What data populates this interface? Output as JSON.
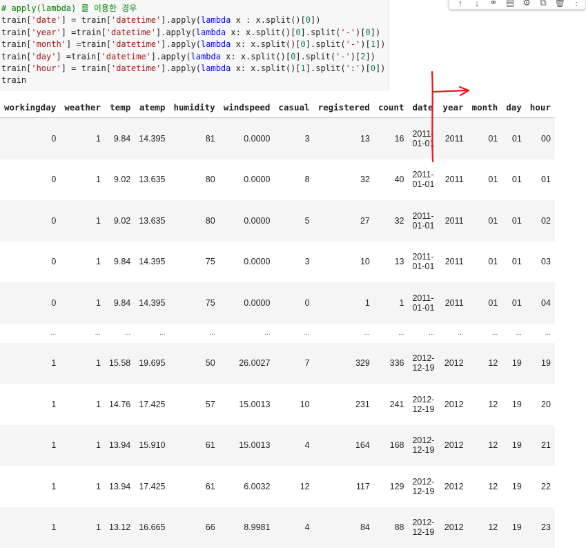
{
  "code": {
    "lines": [
      [
        {
          "t": "# apply(lambda) 를 이용한 경우",
          "c": "c-comment"
        }
      ],
      [
        {
          "t": "train[",
          "c": ""
        },
        {
          "t": "'date'",
          "c": "c-str"
        },
        {
          "t": "] = train[",
          "c": ""
        },
        {
          "t": "'datetime'",
          "c": "c-str"
        },
        {
          "t": "].apply(",
          "c": ""
        },
        {
          "t": "lambda",
          "c": "c-kw"
        },
        {
          "t": " x : x.split()[",
          "c": ""
        },
        {
          "t": "0",
          "c": "c-num"
        },
        {
          "t": "])",
          "c": ""
        }
      ],
      [
        {
          "t": "train[",
          "c": ""
        },
        {
          "t": "'year'",
          "c": "c-str"
        },
        {
          "t": "] =train[",
          "c": ""
        },
        {
          "t": "'datetime'",
          "c": "c-str"
        },
        {
          "t": "].apply(",
          "c": ""
        },
        {
          "t": "lambda",
          "c": "c-kw"
        },
        {
          "t": " x: x.split()[",
          "c": ""
        },
        {
          "t": "0",
          "c": "c-num"
        },
        {
          "t": "].split(",
          "c": ""
        },
        {
          "t": "'-'",
          "c": "c-str"
        },
        {
          "t": ")[",
          "c": ""
        },
        {
          "t": "0",
          "c": "c-num"
        },
        {
          "t": "])",
          "c": ""
        }
      ],
      [
        {
          "t": "train[",
          "c": ""
        },
        {
          "t": "'month'",
          "c": "c-str"
        },
        {
          "t": "] =train[",
          "c": ""
        },
        {
          "t": "'datetime'",
          "c": "c-str"
        },
        {
          "t": "].apply(",
          "c": ""
        },
        {
          "t": "lambda",
          "c": "c-kw"
        },
        {
          "t": " x: x.split()[",
          "c": ""
        },
        {
          "t": "0",
          "c": "c-num"
        },
        {
          "t": "].split(",
          "c": ""
        },
        {
          "t": "'-'",
          "c": "c-str"
        },
        {
          "t": ")[",
          "c": ""
        },
        {
          "t": "1",
          "c": "c-num"
        },
        {
          "t": "])",
          "c": ""
        }
      ],
      [
        {
          "t": "train[",
          "c": ""
        },
        {
          "t": "'day'",
          "c": "c-str"
        },
        {
          "t": "] =train[",
          "c": ""
        },
        {
          "t": "'datetime'",
          "c": "c-str"
        },
        {
          "t": "].apply(",
          "c": ""
        },
        {
          "t": "lambda",
          "c": "c-kw"
        },
        {
          "t": " x: x.split()[",
          "c": ""
        },
        {
          "t": "0",
          "c": "c-num"
        },
        {
          "t": "].split(",
          "c": ""
        },
        {
          "t": "'-'",
          "c": "c-str"
        },
        {
          "t": ")[",
          "c": ""
        },
        {
          "t": "2",
          "c": "c-num"
        },
        {
          "t": "])",
          "c": ""
        }
      ],
      [
        {
          "t": "train[",
          "c": ""
        },
        {
          "t": "'hour'",
          "c": "c-str"
        },
        {
          "t": "] = train[",
          "c": ""
        },
        {
          "t": "'datetime'",
          "c": "c-str"
        },
        {
          "t": "].apply(",
          "c": ""
        },
        {
          "t": "lambda",
          "c": "c-kw"
        },
        {
          "t": " x: x.split()[",
          "c": ""
        },
        {
          "t": "1",
          "c": "c-num"
        },
        {
          "t": "].split(",
          "c": ""
        },
        {
          "t": "':'",
          "c": "c-str"
        },
        {
          "t": ")[",
          "c": ""
        },
        {
          "t": "0",
          "c": "c-num"
        },
        {
          "t": "])",
          "c": ""
        }
      ],
      [
        {
          "t": "train",
          "c": ""
        }
      ]
    ]
  },
  "toolbar": {
    "icons": [
      "arrow-up-icon",
      "arrow-down-icon",
      "link-icon",
      "comment-icon",
      "gear-icon",
      "mirror-cell-icon",
      "delete-icon",
      "more-icon"
    ],
    "glyphs": [
      "↑",
      "↓",
      "⚭",
      "▤",
      "⚙",
      "⧉",
      "🗑",
      "⋮"
    ]
  },
  "table": {
    "columns": [
      "workingday",
      "weather",
      "temp",
      "atemp",
      "humidity",
      "windspeed",
      "casual",
      "registered",
      "count",
      "date",
      "year",
      "month",
      "day",
      "hour"
    ],
    "rows_top": [
      [
        "0",
        "1",
        "9.84",
        "14.395",
        "81",
        "0.0000",
        "3",
        "13",
        "16",
        "2011-01-01",
        "2011",
        "01",
        "01",
        "00"
      ],
      [
        "0",
        "1",
        "9.02",
        "13.635",
        "80",
        "0.0000",
        "8",
        "32",
        "40",
        "2011-01-01",
        "2011",
        "01",
        "01",
        "01"
      ],
      [
        "0",
        "1",
        "9.02",
        "13.635",
        "80",
        "0.0000",
        "5",
        "27",
        "32",
        "2011-01-01",
        "2011",
        "01",
        "01",
        "02"
      ],
      [
        "0",
        "1",
        "9.84",
        "14.395",
        "75",
        "0.0000",
        "3",
        "10",
        "13",
        "2011-01-01",
        "2011",
        "01",
        "01",
        "03"
      ],
      [
        "0",
        "1",
        "9.84",
        "14.395",
        "75",
        "0.0000",
        "0",
        "1",
        "1",
        "2011-01-01",
        "2011",
        "01",
        "01",
        "04"
      ]
    ],
    "ellipsis": "...",
    "rows_bottom": [
      [
        "1",
        "1",
        "15.58",
        "19.695",
        "50",
        "26.0027",
        "7",
        "329",
        "336",
        "2012-12-19",
        "2012",
        "12",
        "19",
        "19"
      ],
      [
        "1",
        "1",
        "14.76",
        "17.425",
        "57",
        "15.0013",
        "10",
        "231",
        "241",
        "2012-12-19",
        "2012",
        "12",
        "19",
        "20"
      ],
      [
        "1",
        "1",
        "13.94",
        "15.910",
        "61",
        "15.0013",
        "4",
        "164",
        "168",
        "2012-12-19",
        "2012",
        "12",
        "19",
        "21"
      ],
      [
        "1",
        "1",
        "13.94",
        "17.425",
        "61",
        "6.0032",
        "12",
        "117",
        "129",
        "2012-12-19",
        "2012",
        "12",
        "19",
        "22"
      ],
      [
        "1",
        "1",
        "13.12",
        "16.665",
        "66",
        "8.9981",
        "4",
        "84",
        "88",
        "2012-12-19",
        "2012",
        "12",
        "19",
        "23"
      ]
    ]
  },
  "annotation_color": "#e8141e"
}
